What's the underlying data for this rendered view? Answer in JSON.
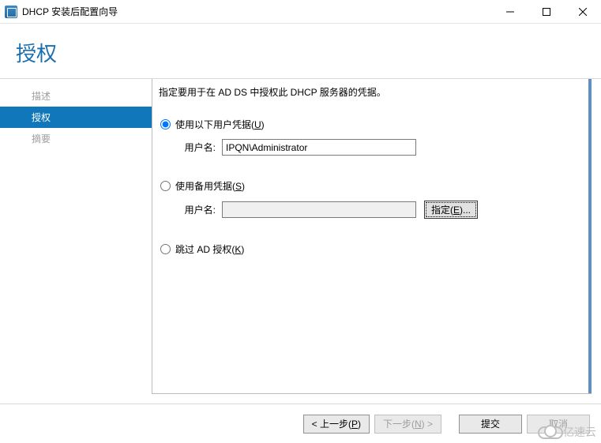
{
  "window": {
    "title": "DHCP 安装后配置向导"
  },
  "header": {
    "title": "授权"
  },
  "sidebar": {
    "items": [
      {
        "label": "描述",
        "active": false
      },
      {
        "label": "授权",
        "active": true
      },
      {
        "label": "摘要",
        "active": false
      }
    ]
  },
  "content": {
    "instruction": "指定要用于在 AD DS 中授权此 DHCP 服务器的凭据。",
    "options": {
      "use_current": {
        "label_pre": "使用以下用户凭据(",
        "hotkey": "U",
        "label_post": ")",
        "selected": true,
        "username_label": "用户名:",
        "username_value": "IPQN\\Administrator"
      },
      "use_alternate": {
        "label_pre": "使用备用凭据(",
        "hotkey": "S",
        "label_post": ")",
        "selected": false,
        "username_label": "用户名:",
        "username_value": "",
        "specify_label_pre": "指定(",
        "specify_hotkey": "E",
        "specify_label_post": ")..."
      },
      "skip": {
        "label_pre": "跳过 AD 授权(",
        "hotkey": "K",
        "label_post": ")",
        "selected": false
      }
    }
  },
  "footer": {
    "prev_pre": "< 上一步(",
    "prev_hotkey": "P",
    "prev_post": ")",
    "next_pre": "下一步(",
    "next_hotkey": "N",
    "next_post": ") >",
    "commit": "提交",
    "cancel": "取消"
  },
  "watermark": "亿速云"
}
